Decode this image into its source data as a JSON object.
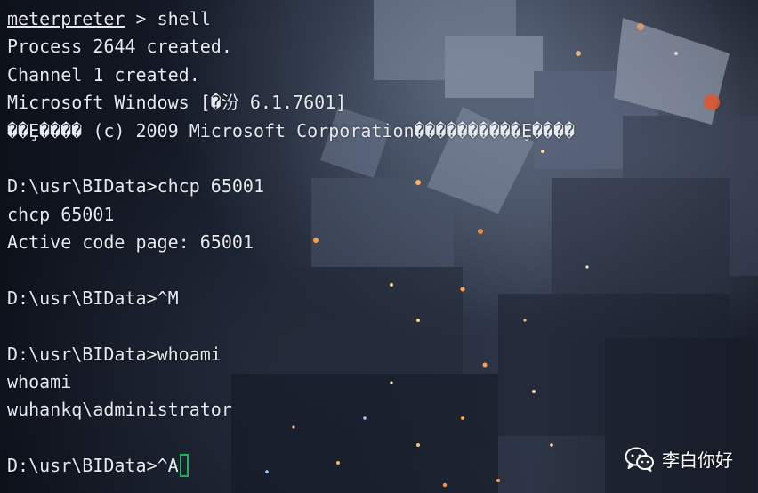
{
  "terminal": {
    "prompt_word": "meterpreter",
    "prompt_rest": " > shell",
    "lines": [
      "Process 2644 created.",
      "Channel 1 created.",
      "Microsoft Windows [�汾 6.1.7601]",
      "��Ȩ���� (c) 2009 Microsoft Corporation����������Ȩ����",
      "",
      "D:\\usr\\BIData>chcp 65001",
      "chcp 65001",
      "Active code page: 65001",
      "",
      "D:\\usr\\BIData>^M",
      "",
      "D:\\usr\\BIData>whoami",
      "whoami",
      "wuhankq\\administrator",
      ""
    ],
    "last_line": "D:\\usr\\BIData>^A",
    "cursor_color": "#19b35a",
    "text_color": "#e6e9ef"
  },
  "watermark": {
    "icon": "wechat-icon",
    "text": "李白你好"
  }
}
